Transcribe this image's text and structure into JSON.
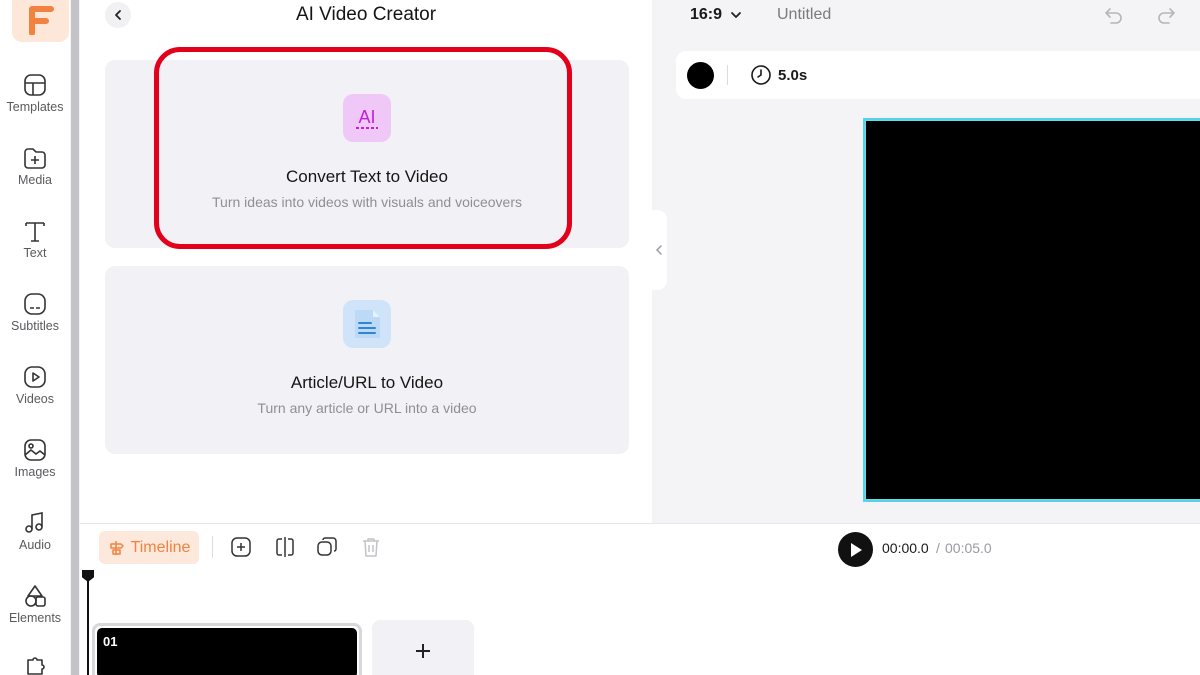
{
  "rail": {
    "items": [
      {
        "label": "Templates",
        "icon": "templates-icon"
      },
      {
        "label": "Media",
        "icon": "media-icon"
      },
      {
        "label": "Text",
        "icon": "text-icon"
      },
      {
        "label": "Subtitles",
        "icon": "subtitles-icon"
      },
      {
        "label": "Videos",
        "icon": "videos-icon"
      },
      {
        "label": "Images",
        "icon": "images-icon"
      },
      {
        "label": "Audio",
        "icon": "audio-icon"
      },
      {
        "label": "Elements",
        "icon": "elements-icon"
      }
    ]
  },
  "panel": {
    "title": "AI Video Creator",
    "cards": [
      {
        "title": "Convert Text to Video",
        "subtitle": "Turn ideas into videos with visuals and voiceovers",
        "icon": "ai-icon",
        "icon_text": "AI"
      },
      {
        "title": "Article/URL to Video",
        "subtitle": "Turn any article or URL into a video",
        "icon": "document-icon"
      }
    ]
  },
  "canvas": {
    "ratio": "16:9",
    "doc_title": "Untitled",
    "duration": "5.0s",
    "background_color": "#000000"
  },
  "timeline": {
    "tab_label": "Timeline",
    "current_time": "00:00.0",
    "separator": "/",
    "total_time": "00:05.0",
    "clips": [
      {
        "number": "01"
      }
    ],
    "add_label": "+"
  },
  "colors": {
    "accent": "#f2823f",
    "highlight": "#e3001b",
    "selection": "#56d3e8"
  }
}
